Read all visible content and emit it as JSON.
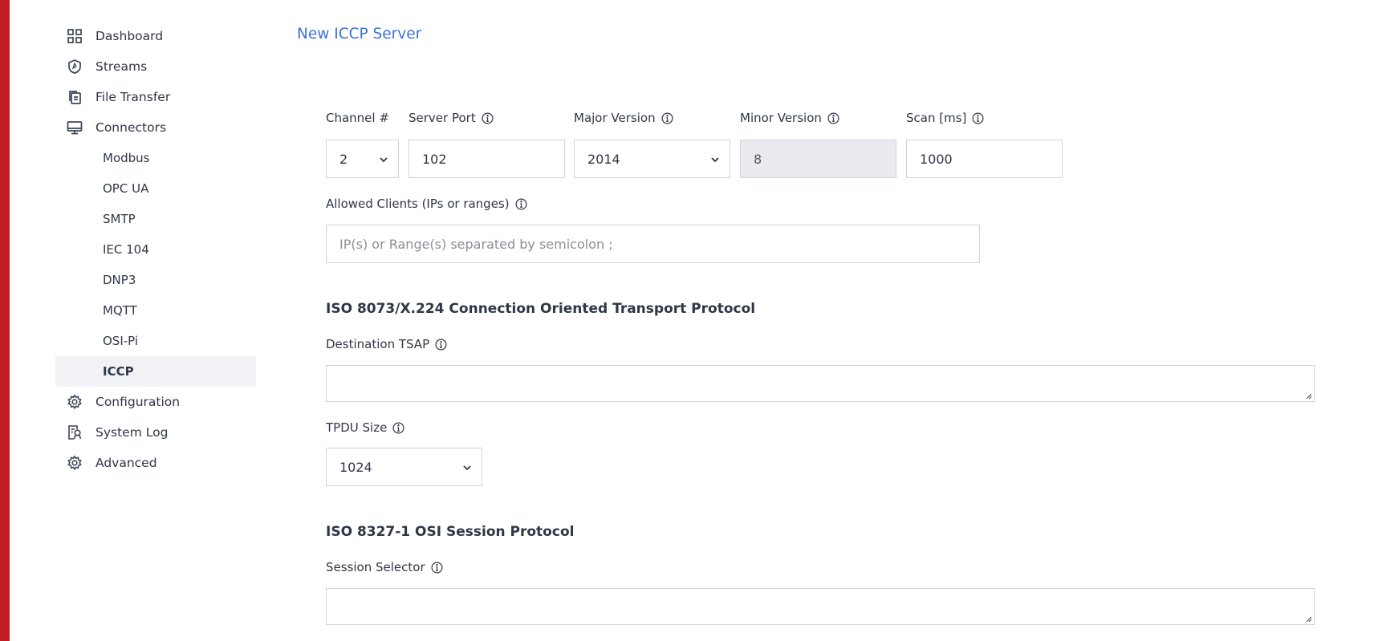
{
  "sidebar": {
    "items": [
      {
        "label": "Dashboard",
        "icon": "dashboard-icon"
      },
      {
        "label": "Streams",
        "icon": "shield-icon"
      },
      {
        "label": "File Transfer",
        "icon": "files-icon"
      },
      {
        "label": "Connectors",
        "icon": "monitor-icon"
      },
      {
        "label": "Modbus"
      },
      {
        "label": "OPC UA"
      },
      {
        "label": "SMTP"
      },
      {
        "label": "IEC 104"
      },
      {
        "label": "DNP3"
      },
      {
        "label": "MQTT"
      },
      {
        "label": "OSI-Pi"
      },
      {
        "label": "ICCP"
      },
      {
        "label": "Configuration",
        "icon": "gear-icon"
      },
      {
        "label": "System Log",
        "icon": "log-icon"
      },
      {
        "label": "Advanced",
        "icon": "gear-icon"
      }
    ]
  },
  "page": {
    "title": "New ICCP Server"
  },
  "form": {
    "channel": {
      "label": "Channel #",
      "value": "2"
    },
    "server_port": {
      "label": "Server Port",
      "value": "102"
    },
    "major_version": {
      "label": "Major Version",
      "value": "2014"
    },
    "minor_version": {
      "label": "Minor Version",
      "value": "8"
    },
    "scan": {
      "label": "Scan [ms]",
      "value": "1000"
    },
    "allowed_clients": {
      "label": "Allowed Clients (IPs or ranges)",
      "value": "",
      "placeholder": "IP(s) or Range(s) separated by semicolon ;"
    },
    "transport_section": "ISO 8073/X.224 Connection Oriented Transport Protocol",
    "destination_tsap": {
      "label": "Destination TSAP",
      "value": ""
    },
    "tpdu_size": {
      "label": "TPDU Size",
      "value": "1024"
    },
    "session_section": "ISO 8327-1 OSI Session Protocol",
    "session_selector": {
      "label": "Session Selector",
      "value": ""
    }
  },
  "colors": {
    "accent": "#3b73d6",
    "brand_bar": "#c41e24",
    "active_bg": "#f1f2f5"
  }
}
